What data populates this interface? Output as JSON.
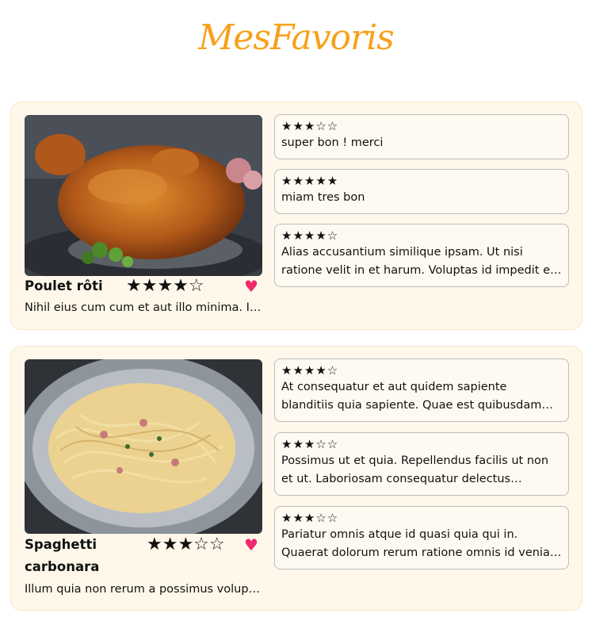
{
  "header": {
    "title": "MesFavoris"
  },
  "colors": {
    "accent": "#f7a11a",
    "heart": "#f0286c",
    "card_bg": "#fff8ea"
  },
  "recipes": [
    {
      "name": "Poulet rôti",
      "rating": 4,
      "rating_stars": "★★★★☆",
      "favorite_icon": "heart-icon",
      "description": "Nihil eius cum cum et aut illo minima. Illo quia non rerum a possimus voluptatibus.",
      "reviews": [
        {
          "stars": "★★★☆☆",
          "text": "super bon ! merci"
        },
        {
          "stars": "★★★★★",
          "text": "miam tres bon"
        },
        {
          "stars": "★★★★☆",
          "text": "Alias accusantium similique ipsam. Ut nisi ratione velit in et harum. Voluptas id impedit et est quibusdam."
        }
      ]
    },
    {
      "name": "Spaghetti carbonara",
      "rating": 3,
      "rating_stars": "★★★☆☆",
      "favorite_icon": "heart-icon",
      "description": "Illum quia non rerum a possimus voluptatibus et aut illo minima.",
      "reviews": [
        {
          "stars": "★★★★☆",
          "text": "At consequatur et aut quidem sapiente blanditiis quia sapiente. Quae est quibusdam dignissimos et illo."
        },
        {
          "stars": "★★★☆☆",
          "text": "Possimus ut et quia. Repellendus facilis ut non et ut. Laboriosam consequatur delectus voluptatem quia."
        },
        {
          "stars": "★★★☆☆",
          "text": "Pariatur omnis atque id quasi quia qui in. Quaerat dolorum rerum ratione omnis id veniam soluta. Illo et aut."
        }
      ]
    }
  ]
}
